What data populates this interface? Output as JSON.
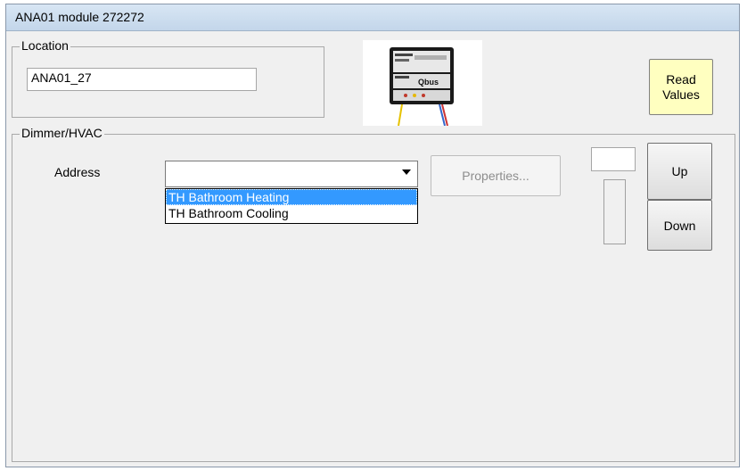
{
  "window": {
    "title": "ANA01 module 272272"
  },
  "location": {
    "group_label": "Location",
    "value": "ANA01_27"
  },
  "read_values": {
    "line1": "Read",
    "line2": "Values"
  },
  "dimmer": {
    "group_label": "Dimmer/HVAC",
    "address_label": "Address",
    "address_value": "",
    "properties_label": "Properties...",
    "dropdown_options": [
      "TH Bathroom Heating",
      "TH Bathroom Cooling"
    ],
    "selected_option_index": 0,
    "level_value": "",
    "up_label": "Up",
    "down_label": "Down"
  },
  "device_image": {
    "brand_text": "Qbus"
  },
  "colors": {
    "selection": "#3399ff",
    "read_button": "#ffffc0",
    "title_bar": "#c3d6ea"
  }
}
